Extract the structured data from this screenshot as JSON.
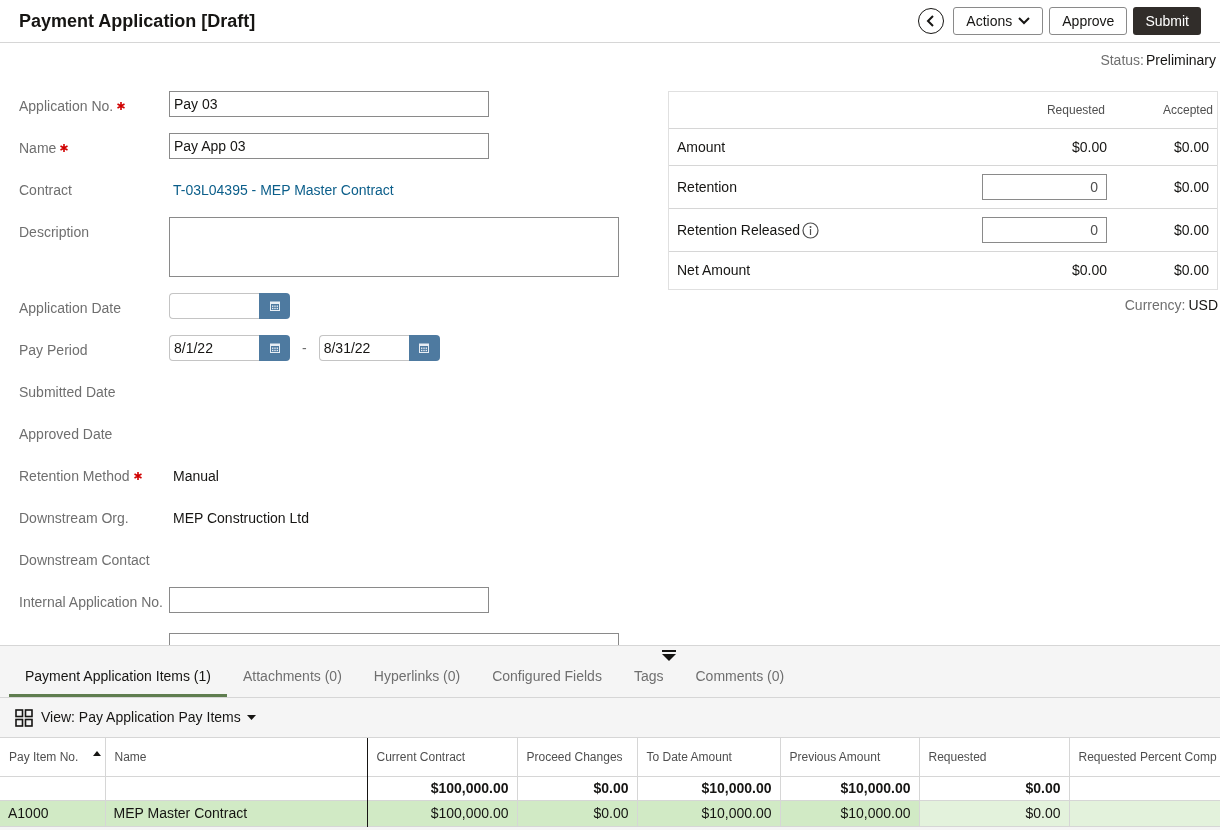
{
  "header": {
    "title": "Payment Application [Draft]",
    "buttons": [
      {
        "label": "Actions",
        "kind": "menu"
      },
      {
        "label": "Approve",
        "kind": "default"
      },
      {
        "label": "Submit",
        "kind": "primary"
      }
    ]
  },
  "status": {
    "label": "Status:",
    "value": "Preliminary"
  },
  "form": [
    {
      "label": "Application No.",
      "required": true,
      "kind": "text",
      "value": "Pay 03"
    },
    {
      "label": "Name",
      "required": true,
      "kind": "text",
      "value": "Pay App 03"
    },
    {
      "label": "Contract",
      "required": false,
      "kind": "link",
      "value": "T-03L04395 - MEP Master Contract"
    },
    {
      "label": "Description",
      "required": false,
      "kind": "textarea"
    },
    {
      "label": "Application Date",
      "required": false,
      "kind": "date"
    },
    {
      "label": "Pay Period",
      "required": false,
      "kind": "daterange",
      "value": "8/1/22",
      "separator": "-",
      "value_end": "8/31/22"
    },
    {
      "label": "Submitted Date",
      "required": false,
      "kind": "static"
    },
    {
      "label": "Approved Date",
      "required": false,
      "kind": "static"
    },
    {
      "label": "Retention Method",
      "required": true,
      "kind": "static",
      "value": "Manual"
    },
    {
      "label": "Downstream Org.",
      "required": false,
      "kind": "static",
      "value": "MEP Construction Ltd"
    },
    {
      "label": "Downstream Contact",
      "required": false,
      "kind": "static"
    },
    {
      "label": "Internal Application No.",
      "required": false,
      "kind": "text"
    },
    {
      "required": false,
      "kind": "wide"
    }
  ],
  "summary": {
    "columns": [
      "Requested",
      "Accepted"
    ],
    "rows": [
      {
        "label": "Amount",
        "kind": "value",
        "info": false,
        "requested": "$0.00",
        "accepted": "$0.00"
      },
      {
        "label": "Retention",
        "kind": "input",
        "info": false,
        "requested": "0",
        "accepted": "$0.00"
      },
      {
        "label": "Retention Released",
        "kind": "input",
        "info": true,
        "requested": "0",
        "accepted": "$0.00"
      },
      {
        "label": "Net Amount",
        "kind": "value",
        "info": false,
        "requested": "$0.00",
        "accepted": "$0.00"
      }
    ],
    "currency": {
      "label": "Currency:",
      "value": "USD"
    }
  },
  "tabs": [
    {
      "label": "Payment Application Items (1)",
      "selected": true
    },
    {
      "label": "Attachments (0)",
      "selected": false
    },
    {
      "label": "Hyperlinks (0)",
      "selected": false
    },
    {
      "label": "Configured Fields",
      "selected": false
    },
    {
      "label": "Tags",
      "selected": false
    },
    {
      "label": "Comments (0)",
      "selected": false
    }
  ],
  "view": {
    "label": "View: Pay Application Pay Items"
  },
  "grid": {
    "columns": [
      {
        "label": "Pay Item No.",
        "sorted": true
      },
      {
        "label": "Name",
        "sorted": false
      },
      {
        "label": "Current Contract",
        "sorted": false,
        "total": "$100,000.00"
      },
      {
        "label": "Proceed Changes",
        "sorted": false,
        "total": "$0.00"
      },
      {
        "label": "To Date Amount",
        "sorted": false,
        "total": "$10,000.00"
      },
      {
        "label": "Previous Amount",
        "sorted": false,
        "total": "$10,000.00"
      },
      {
        "label": "Requested",
        "sorted": false,
        "total": "$0.00"
      },
      {
        "label": "Requested Percent Comp",
        "sorted": false
      }
    ],
    "rows": [
      {
        "selected": true,
        "cells": [
          "A1000",
          "MEP Master Contract",
          "$100,000.00",
          "$0.00",
          "$10,000.00",
          "$10,000.00",
          "$0.00"
        ]
      }
    ]
  }
}
